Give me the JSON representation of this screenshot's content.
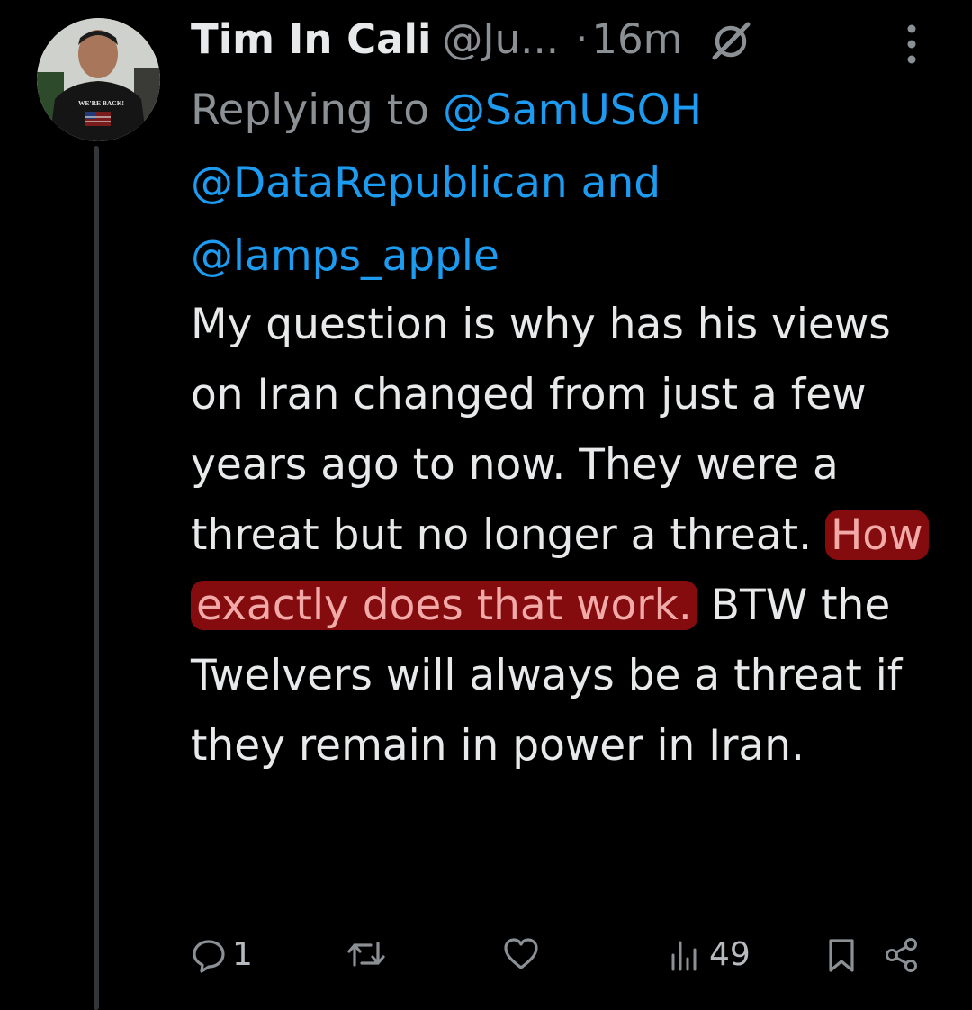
{
  "tweet": {
    "author_name": "Tim In Cali",
    "author_handle": "@Ju...",
    "separator": "·",
    "timestamp": "16m",
    "avatar_shirt_text": "WE'RE BACK!",
    "replying_to_prefix": "Replying to",
    "mention_1": "@SamUSOH",
    "mention_2": "@DataRepublican",
    "conjunction": "and",
    "mention_3": "@lamps_apple",
    "body_part_1": "My question is why has his views on Iran changed from just a few years ago to now. They were a threat but no longer a threat.",
    "body_highlighted": "How exactly does that work.",
    "body_part_2": "BTW the Twelvers will always be a threat if they remain in power in Iran."
  },
  "actions": {
    "reply_count": "1",
    "retweet_count": "",
    "like_count": "",
    "views_count": "49"
  },
  "colors": {
    "background": "#000000",
    "text": "#e7e9ea",
    "secondary": "#8b9095",
    "link": "#1d9bf0",
    "highlight": "#960c10"
  },
  "icons": [
    "grok-icon",
    "more-icon",
    "reply-icon",
    "retweet-icon",
    "like-icon",
    "views-icon",
    "bookmark-icon",
    "share-icon"
  ]
}
